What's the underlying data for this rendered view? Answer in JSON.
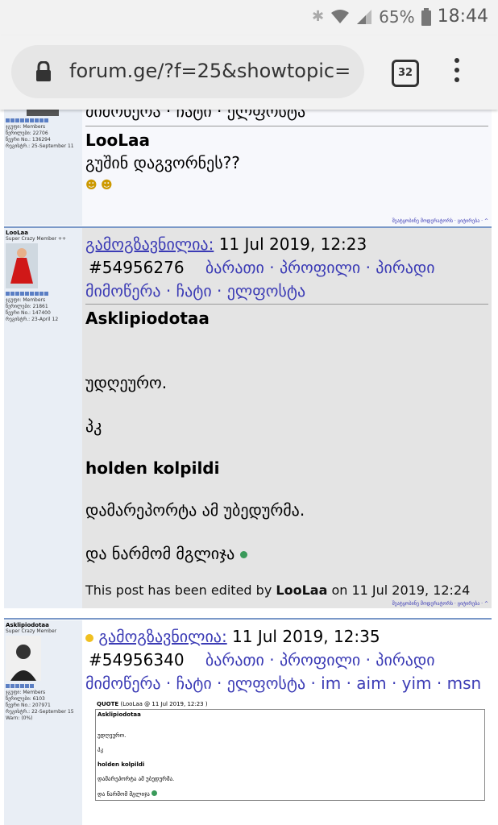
{
  "status_bar": {
    "battery": "65%",
    "time": "18:44"
  },
  "browser": {
    "url": "forum.ge/?f=25&showtopic=",
    "tab_count": "32"
  },
  "posts": [
    {
      "partial_header": "მიმოწერა · ჩატი · ელფოსტა",
      "member_group": "ჯგუფი: Members",
      "posts_count": "წერილები: 22706",
      "member_no": "წევრი No.: 136294",
      "registered": "რეგისტრ.: 25-September 11",
      "author_quoted": "LooLaa",
      "body_line": "გუშინ დაგვორნეს??",
      "footer": "შეატყობინე მოდერატორს · ციტირება · ^"
    },
    {
      "username": "LooLaa",
      "user_title": "Super Crazy Member ++",
      "member_group": "ჯგუფი: Members",
      "posts_count": "წერილები: 21861",
      "member_no": "წევრი No.: 147400",
      "registered": "რეგისტრ.: 23-April 12",
      "sent_label": "გამოგზავნილია:",
      "date": "11 Jul 2019, 12:23",
      "post_id": "#54956276",
      "links_line1": "ბარათი · პროფილი · პირადი",
      "links_line2": "მიმოწერა · ჩატი · ელფოსტა",
      "author_quoted": "Asklipiodotaa",
      "line1": "უდღეურო.",
      "line2": "პკ",
      "line3": "holden kolpildi",
      "line4": "დამარეპორტა ამ უბედურმა.",
      "line5": "და ნარმომ მგლიჯა",
      "edited_prefix": "This post has been edited by",
      "edited_by": "LooLaa",
      "edited_suffix": "on 11 Jul 2019, 12:24",
      "footer": "შეატყობინე მოდერატორს · ციტირება · ^"
    },
    {
      "username": "Asklipiodotaa",
      "user_title": "Super Crazy Member",
      "member_group": "ჯგუფი: Members",
      "posts_count": "წერილები: 6103",
      "member_no": "წევრი No.: 207971",
      "registered": "რეგისტრ.: 22-September 15",
      "warn": "Warn: (0%)",
      "sent_label": "გამოგზავნილია:",
      "date": "11 Jul 2019, 12:35",
      "post_id": "#54956340",
      "links_line1": "ბარათი · პროფილი · პირადი",
      "links_line2": "მიმოწერა · ჩატი · ელფოსტა · im · aim · yim · msn",
      "quote_header": "QUOTE",
      "quote_meta": "(LooLaa @ 11 Jul 2019, 12:23 )",
      "quote_author": "Asklipiodotaa",
      "quote_line1": "უდღეურო.",
      "quote_line2": "პკ",
      "quote_line3": "holden kolpildi",
      "quote_line4": "დამარეპორტა ამ უბედურმა.",
      "quote_line5": "და ნარმომ მგლიჯა"
    }
  ]
}
